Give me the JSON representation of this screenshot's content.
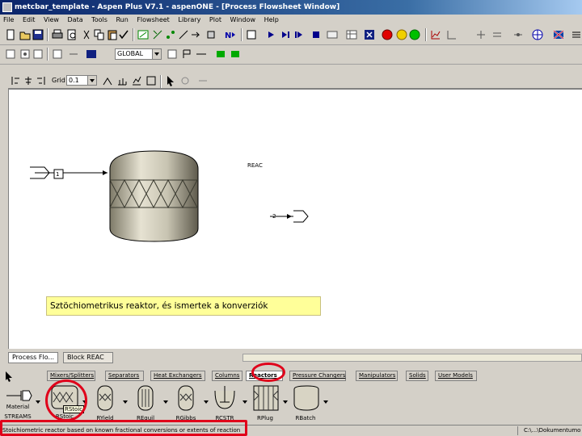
{
  "window": {
    "title": "metcbar_template - Aspen Plus V7.1 - aspenONE - [Process Flowsheet Window]"
  },
  "menu": [
    "File",
    "Edit",
    "View",
    "Data",
    "Tools",
    "Run",
    "Flowsheet",
    "Library",
    "Plot",
    "Window",
    "Help"
  ],
  "toolbar2": {
    "combo_value": "GLOBAL"
  },
  "flowsheet_toolbar": {
    "grid_label": "Grid",
    "grid_value": "0.1"
  },
  "flowsheet": {
    "block_label": "REAC",
    "stream_in_id": "1",
    "stream_out_id": "2",
    "annotation": "Sztöchiometrikus reaktor, és ismertek a konverziók"
  },
  "window_tabs": [
    "Process Flo...",
    "Block REAC"
  ],
  "library_tabs": [
    "Mixers/Splitters",
    "Separators",
    "Heat Exchangers",
    "Columns",
    "Reactors",
    "Pressure Changers",
    "Manipulators",
    "Solids",
    "User Models"
  ],
  "active_library_tab": "Reactors",
  "models": {
    "material_label": "Material",
    "material_sublabel": "STREAMS",
    "items": [
      {
        "label": "RStoic",
        "tooltip": "RStoic"
      },
      {
        "label": "RYield"
      },
      {
        "label": "REquil"
      },
      {
        "label": "RGibbs"
      },
      {
        "label": "RCSTR"
      },
      {
        "label": "RPlug"
      },
      {
        "label": "RBatch"
      }
    ]
  },
  "status_bar": {
    "message": "Stoichiometric reactor based on known fractional conversions or extents of reaction",
    "path": "C:\\...\\Dokumentumok\\Aspen"
  },
  "colors": {
    "highlight": "#e0001a",
    "annotation_bg": "#ffff99",
    "title_blue": "#0a246a"
  }
}
